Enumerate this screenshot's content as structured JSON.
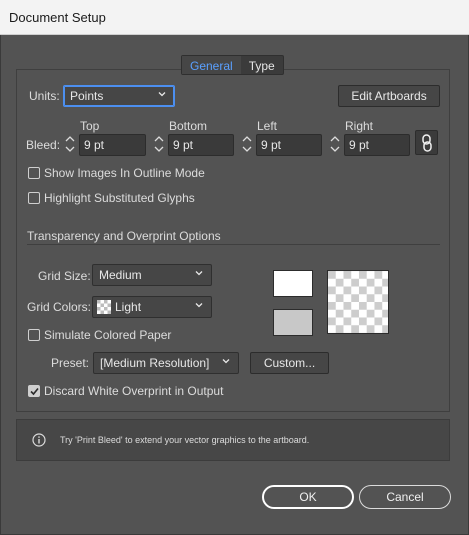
{
  "window": {
    "title": "Document Setup"
  },
  "tabs": [
    {
      "label": "General",
      "active": true
    },
    {
      "label": "Type",
      "active": false
    }
  ],
  "units": {
    "label": "Units:",
    "value": "Points"
  },
  "edit_artboards_label": "Edit Artboards",
  "bleed": {
    "label": "Bleed:",
    "columns": [
      "Top",
      "Bottom",
      "Left",
      "Right"
    ],
    "values": [
      "9 pt",
      "9 pt",
      "9 pt",
      "9 pt"
    ]
  },
  "options": {
    "show_images_outline": {
      "label": "Show Images In Outline Mode",
      "checked": false
    },
    "highlight_substituted_glyphs": {
      "label": "Highlight Substituted Glyphs",
      "checked": false
    }
  },
  "transparency": {
    "section_title": "Transparency and Overprint Options",
    "grid_size": {
      "label": "Grid Size:",
      "value": "Medium"
    },
    "grid_colors": {
      "label": "Grid Colors:",
      "value": "Light"
    },
    "simulate_paper": {
      "label": "Simulate Colored Paper",
      "checked": false
    },
    "preset": {
      "label": "Preset:",
      "value": "[Medium Resolution]"
    },
    "custom_label": "Custom...",
    "discard_white": {
      "label": "Discard White Overprint in Output",
      "checked": true
    },
    "swatch_colors": {
      "top": "#ffffff",
      "bottom": "#c8c8c8"
    }
  },
  "info": {
    "text": "Try 'Print Bleed' to extend your vector graphics to the artboard."
  },
  "buttons": {
    "ok": "OK",
    "cancel": "Cancel"
  }
}
